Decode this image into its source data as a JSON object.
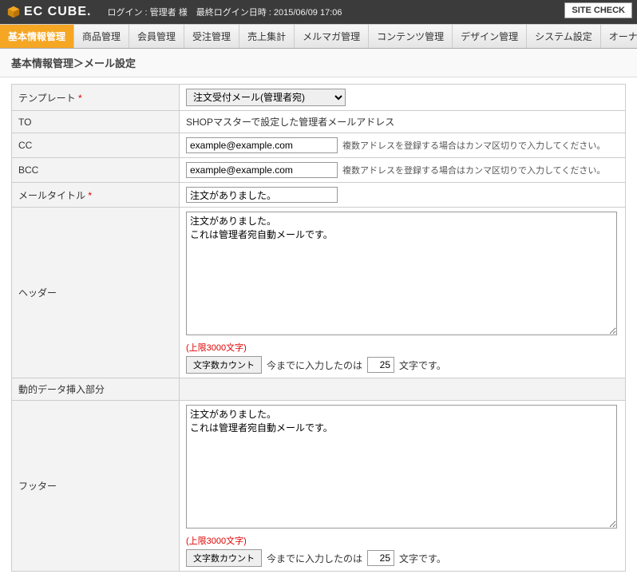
{
  "header": {
    "logo_text": "EC CUBE",
    "login_label": "ログイン : 管理者 様　最終ログイン日時 :",
    "login_time": "2015/06/09 17:06",
    "site_check": "SITE CHECK"
  },
  "nav": {
    "items": [
      {
        "label": "基本情報管理",
        "active": true
      },
      {
        "label": "商品管理",
        "active": false
      },
      {
        "label": "会員管理",
        "active": false
      },
      {
        "label": "受注管理",
        "active": false
      },
      {
        "label": "売上集計",
        "active": false
      },
      {
        "label": "メルマガ管理",
        "active": false
      },
      {
        "label": "コンテンツ管理",
        "active": false
      },
      {
        "label": "デザイン管理",
        "active": false
      },
      {
        "label": "システム設定",
        "active": false
      },
      {
        "label": "オーナーズストア",
        "active": false
      }
    ]
  },
  "breadcrumb": "基本情報管理＞メール設定",
  "form": {
    "template": {
      "label": "テンプレート",
      "required": "*",
      "value": "注文受付メール(管理者宛)"
    },
    "to": {
      "label": "TO",
      "value": "SHOPマスターで設定した管理者メールアドレス"
    },
    "cc": {
      "label": "CC",
      "value": "example@example.com",
      "hint": "複数アドレスを登録する場合はカンマ区切りで入力してください。"
    },
    "bcc": {
      "label": "BCC",
      "value": "example@example.com",
      "hint": "複数アドレスを登録する場合はカンマ区切りで入力してください。"
    },
    "mail_title": {
      "label": "メールタイトル",
      "required": "*",
      "value": "注文がありました。"
    },
    "header": {
      "label": "ヘッダー",
      "text": "注文がありました。\nこれは管理者宛自動メールです。",
      "limit": "(上限3000文字)",
      "count_button": "文字数カウント",
      "count_prefix": "今までに入力したのは",
      "count_value": "25",
      "count_suffix": "文字です。"
    },
    "dynamic_section": "動的データ挿入部分",
    "footer": {
      "label": "フッター",
      "text": "注文がありました。\nこれは管理者宛自動メールです。",
      "limit": "(上限3000文字)",
      "count_button": "文字数カウント",
      "count_prefix": "今までに入力したのは",
      "count_value": "25",
      "count_suffix": "文字です。"
    }
  }
}
